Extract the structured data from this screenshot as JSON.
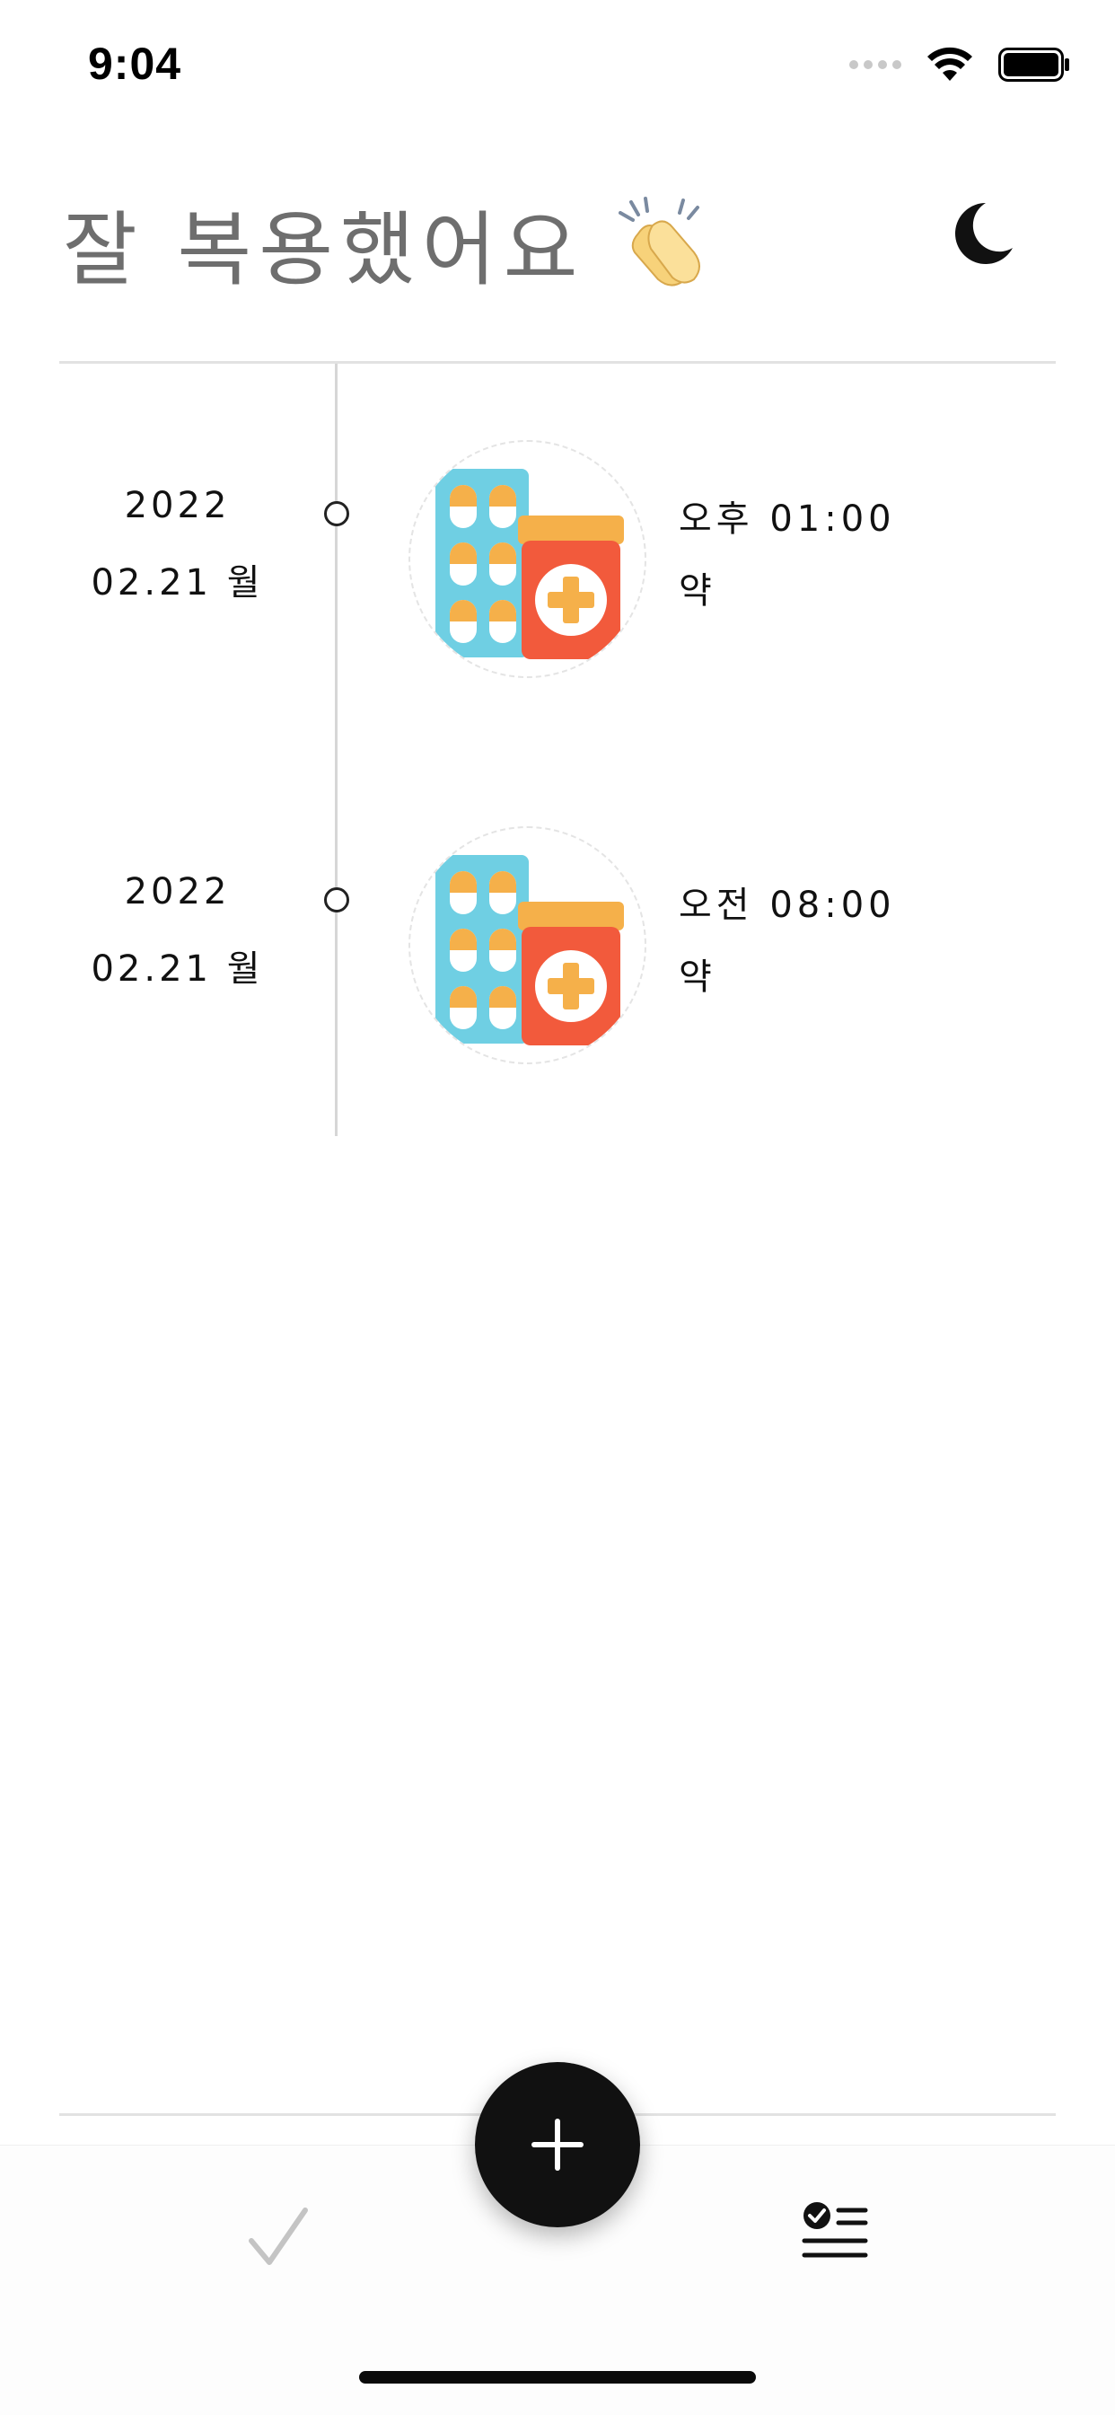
{
  "status_bar": {
    "time": "9:04",
    "icons": [
      "signal-icon",
      "wifi-icon",
      "battery-icon"
    ]
  },
  "header": {
    "title": "잘 복용했어요",
    "title_emoji": "clap-icon",
    "theme_toggle_icon": "moon-icon"
  },
  "timeline": {
    "entries": [
      {
        "year": "2022",
        "date": "02.21 월",
        "time": "오후 01:00",
        "name": "약",
        "image_icon": "medicine-icon"
      },
      {
        "year": "2022",
        "date": "02.21 월",
        "time": "오전 08:00",
        "name": "약",
        "image_icon": "medicine-icon"
      }
    ]
  },
  "tab_bar": {
    "tabs": [
      {
        "icon": "check-icon",
        "selected": false
      },
      {
        "icon": "checklist-icon",
        "selected": true
      }
    ],
    "add_button_icon": "plus-icon"
  },
  "colors": {
    "title": "#6e6e6e",
    "accent": "#111111",
    "divider": "#e2e2e2",
    "pill_pack": "#6fcfe3",
    "pill_top": "#f5b04a",
    "bottle": "#f25a3c",
    "bottle_lid": "#f5b04a"
  }
}
